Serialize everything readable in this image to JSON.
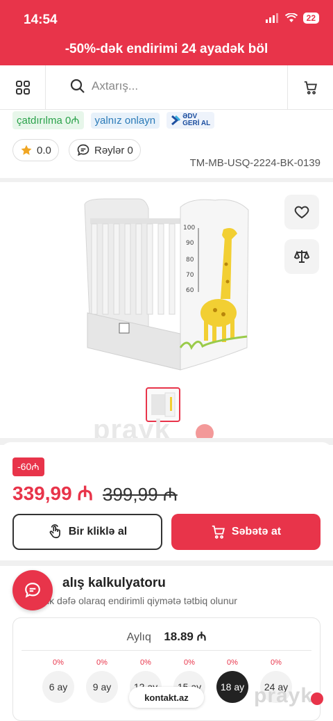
{
  "status_bar": {
    "time": "14:54",
    "battery": "22"
  },
  "promo_banner": "-50%-dək endirimi 24 ayadək böl",
  "search": {
    "placeholder": "Axtarış..."
  },
  "tags": {
    "delivery": "çatdırılma 0₼",
    "online": "yalnız onlayn",
    "adv_line1": "ƏDV",
    "adv_line2": "GERİ AL"
  },
  "rating": {
    "score": "0.0",
    "reviews": "Rəylər 0"
  },
  "sku": "TM-MB-USQ-2224-BK-0139",
  "product_image": {
    "scale_marks": [
      "100",
      "90",
      "80",
      "70",
      "60"
    ]
  },
  "watermark": "prayk",
  "price": {
    "discount_badge": "-60₼",
    "current": "339,99 ₼",
    "old": "399,99 ₼"
  },
  "buttons": {
    "one_click": "Bir kliklə al",
    "add_to_cart": "Səbətə at"
  },
  "calculator": {
    "title": "alış kalkulyatoru",
    "subtitle": "ik dəfə olaraq endirimli qiymətə tətbiq olunur",
    "monthly_label": "Aylıq",
    "monthly_value": "18.89 ₼",
    "terms": [
      {
        "pct": "0%",
        "label": "6 ay"
      },
      {
        "pct": "0%",
        "label": "9 ay"
      },
      {
        "pct": "0%",
        "label": "12 ay"
      },
      {
        "pct": "0%",
        "label": "15 ay"
      },
      {
        "pct": "0%",
        "label": "18 ay"
      },
      {
        "pct": "0%",
        "label": "24 ay"
      }
    ],
    "selected_term": "18 ay"
  },
  "contact_chip": "kontakt.az",
  "colors": {
    "accent": "#e8344a",
    "success": "#2aa24a",
    "link": "#2a7ab8"
  }
}
